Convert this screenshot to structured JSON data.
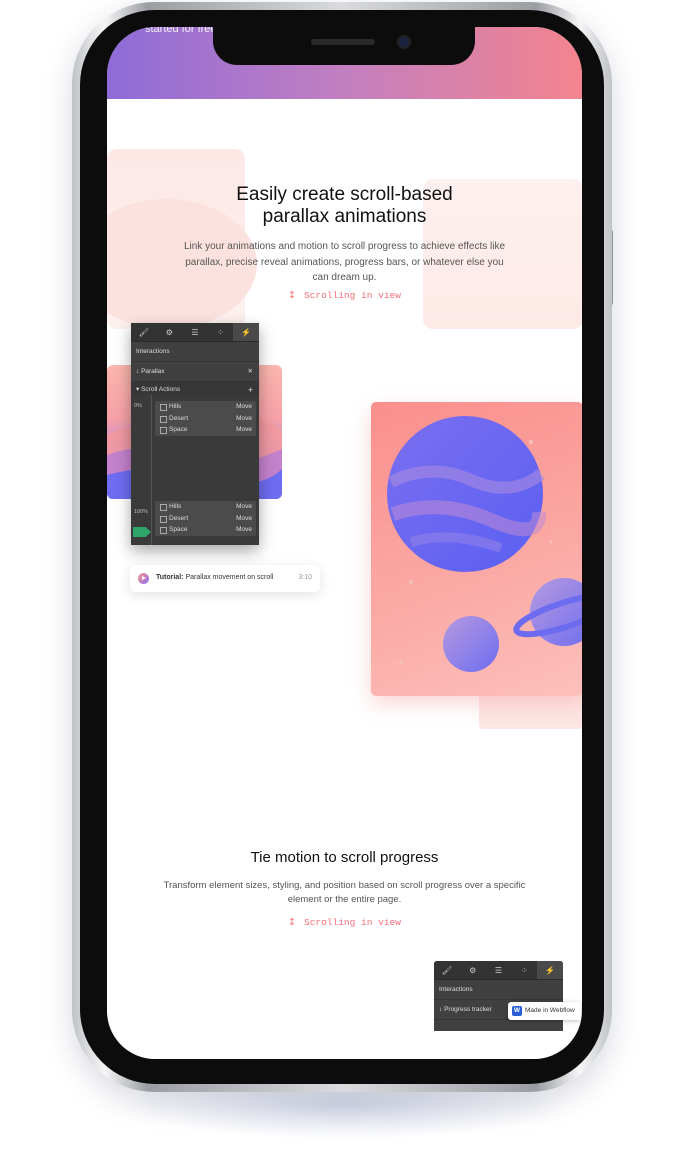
{
  "hero": {
    "partial_text": "started for free"
  },
  "section1": {
    "title_line1": "Easily create scroll-based",
    "title_line2": "parallax animations",
    "body": "Link your animations and motion to scroll progress to achieve effects like parallax, precise reveal animations, progress bars, or whatever else you can dream up.",
    "link": "Scrolling in view"
  },
  "panel": {
    "tabs": [
      "brush-icon",
      "gear-icon",
      "layers-icon",
      "drops-icon",
      "lightning-icon"
    ],
    "header": "Interactions",
    "interaction_name": "Parallax",
    "section": "Scroll Actions",
    "start_pct": "0%",
    "end_pct": "100%",
    "group_top": [
      {
        "name": "Hills",
        "action": "Move"
      },
      {
        "name": "Desert",
        "action": "Move"
      },
      {
        "name": "Space",
        "action": "Move"
      }
    ],
    "group_bottom": [
      {
        "name": "Hills",
        "action": "Move"
      },
      {
        "name": "Desert",
        "action": "Move"
      },
      {
        "name": "Space",
        "action": "Move"
      }
    ]
  },
  "tutorial": {
    "prefix": "Tutorial:",
    "title": "Parallax movement on scroll",
    "duration": "3:10"
  },
  "section2": {
    "title": "Tie motion to scroll progress",
    "body": "Transform element sizes, styling, and position based on scroll progress over a specific element or the entire page.",
    "link": "Scrolling in view"
  },
  "panel2": {
    "header": "Interactions",
    "interaction_name": "Progress tracker"
  },
  "badge": {
    "logo": "W",
    "label": "Made in Webflow"
  },
  "colors": {
    "accent": "#f46d77",
    "gradient_start": "#8e6bd8",
    "gradient_end": "#f3848e",
    "panel_bg": "#404040",
    "marker": "#2ea66a"
  }
}
